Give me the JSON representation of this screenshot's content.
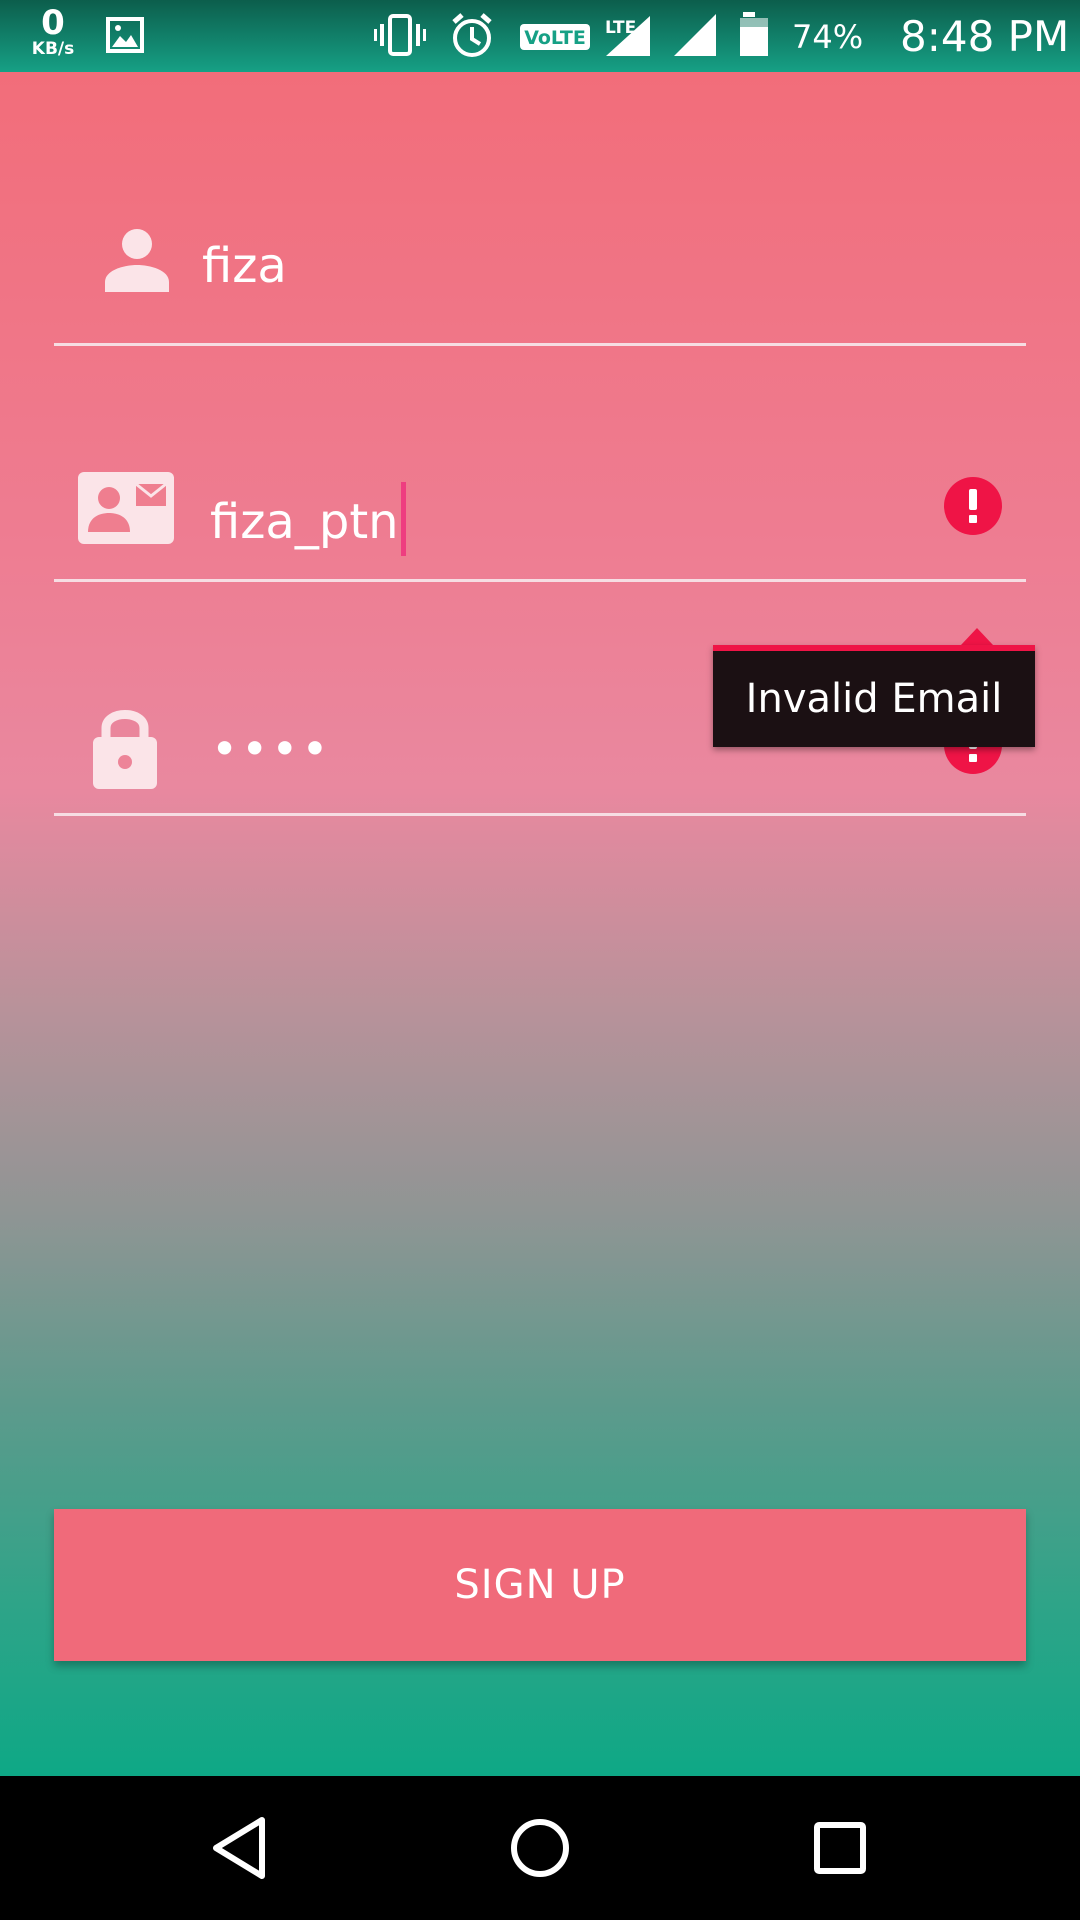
{
  "status_bar": {
    "net_speed_value": "0",
    "net_speed_unit": "KB/s",
    "battery_percent": "74%",
    "time": "8:48 PM",
    "icons": [
      "gallery-icon",
      "vibrate-icon",
      "alarm-icon",
      "volte-icon",
      "lte-signal-icon",
      "signal-icon",
      "battery-icon"
    ]
  },
  "form": {
    "name": {
      "value": "fiza",
      "icon": "person-icon"
    },
    "email": {
      "value": "fiza_ptn",
      "icon": "contact-card-icon",
      "error": "Invalid Email"
    },
    "password": {
      "value": "••••",
      "icon": "lock-icon"
    }
  },
  "signup_button_label": "SIGN UP",
  "nav_bar": {
    "icons": [
      "back-icon",
      "home-icon",
      "recents-icon"
    ]
  },
  "colors": {
    "accent": "#f06a7a",
    "error": "#ef1446",
    "status_bar": "#16a085"
  }
}
